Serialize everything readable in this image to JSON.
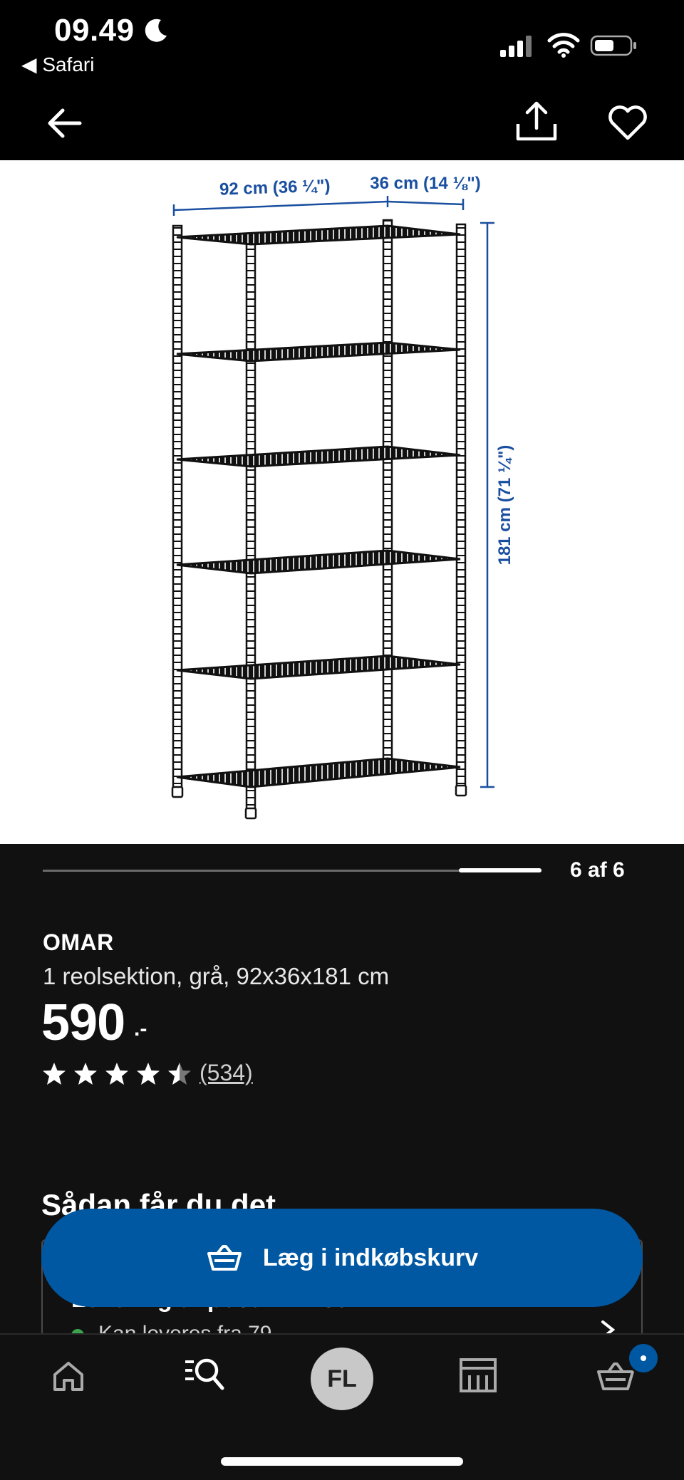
{
  "status_bar": {
    "time": "09.49",
    "back_app": "◀ Safari"
  },
  "icons": {
    "moon": "moon-icon",
    "signal": "cellular-signal-icon",
    "wifi": "wifi-icon",
    "battery": "battery-icon",
    "back": "arrow-left-icon",
    "share": "share-icon",
    "favorite": "heart-icon"
  },
  "gallery": {
    "counter": "6 af 6",
    "current": 6,
    "total": 6,
    "dimension_width": "92 cm (36 ¼\")",
    "dimension_depth": "36 cm (14 ⅛\")",
    "dimension_height": "181 cm (71 ¼\")"
  },
  "product": {
    "name": "OMAR",
    "description": "1 reolsektion, grå, 92x36x181 cm",
    "price": "590",
    "price_suffix": ".-",
    "rating": 4.5,
    "review_count": "(534)"
  },
  "delivery": {
    "heading": "Sådan får du det",
    "title": "Levering til postnr. 2730",
    "status": "Kan leveres fra 79"
  },
  "cart_button": {
    "label": "Læg i indkøbskurv"
  },
  "tabs": {
    "avatar_initials": "FL",
    "items": [
      "home-icon",
      "search-icon",
      "avatar",
      "store-icon",
      "cart-icon"
    ]
  },
  "colors": {
    "background": "#111111",
    "accent": "#0058a3",
    "dimension_blue": "#1a4fa0"
  }
}
